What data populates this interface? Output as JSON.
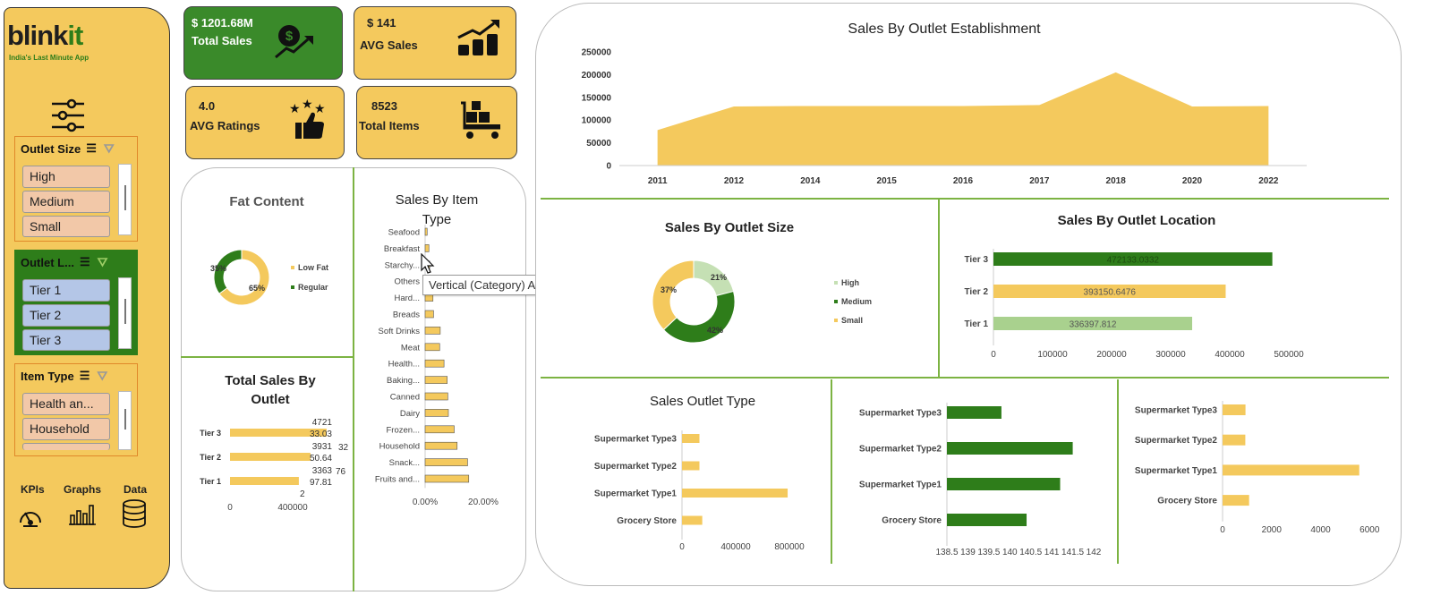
{
  "brand": {
    "name_a": "blink",
    "name_b": "it",
    "tagline": "India's Last Minute App"
  },
  "colors": {
    "yellow": "#f4c95d",
    "green": "#2e7d1a",
    "light_green": "#a9d18e",
    "peach": "#f2c8a8",
    "lavender": "#b4c6e7"
  },
  "slicers": [
    {
      "title": "Outlet Size",
      "items": [
        "High",
        "Medium",
        "Small"
      ]
    },
    {
      "title": "Outlet L...",
      "items": [
        "Tier 1",
        "Tier 2",
        "Tier 3"
      ]
    },
    {
      "title": "Item Type",
      "items": [
        "Health an...",
        "Household"
      ]
    }
  ],
  "nav": {
    "kpis": "KPIs",
    "graphs": "Graphs",
    "data": "Data"
  },
  "kpis": {
    "total_sales": {
      "value": "$ 1201.68M",
      "label": "Total Sales",
      "icon": "money-growth-icon"
    },
    "avg_sales": {
      "value": "$ 141",
      "label": "AVG Sales",
      "icon": "bar-growth-icon"
    },
    "avg_ratings": {
      "value": "4.0",
      "label": "AVG Ratings",
      "icon": "stars-thumbs-up-icon"
    },
    "total_items": {
      "value": "8523",
      "label": "Total Items",
      "icon": "cart-icon"
    }
  },
  "tooltip": "Vertical (Category) Axis",
  "chart_data": [
    {
      "id": "fat",
      "type": "pie",
      "title": "Fat Content",
      "labels": [
        "Low Fat",
        "Regular"
      ],
      "values": [
        65,
        35
      ],
      "value_labels": [
        "65%",
        "35%"
      ],
      "colors": [
        "#f4c95d",
        "#2e7d1a"
      ],
      "legend": "right"
    },
    {
      "id": "total_by_outlet",
      "type": "bar",
      "title": "Total Sales By Outlet",
      "categories": [
        "Tier 3",
        "Tier 2",
        "Tier 1"
      ],
      "values": [
        472133.03,
        393150.64,
        336397.81
      ],
      "label_lines": [
        [
          "4721",
          "33.03"
        ],
        [
          "3931",
          "50.64"
        ],
        [
          "3363",
          "97.81"
        ]
      ],
      "extra_labels": [
        "32",
        "76",
        "2"
      ],
      "xticks": [
        "0",
        "400000"
      ],
      "xmax": 700000
    },
    {
      "id": "item_type",
      "type": "bar",
      "title": "Sales By Item Type",
      "categories": [
        "Seafood",
        "Breakfast",
        "Starchy...",
        "Others",
        "Hard...",
        "Breads",
        "Soft Drinks",
        "Meat",
        "Health...",
        "Baking...",
        "Canned",
        "Dairy",
        "Frozen...",
        "Household",
        "Snack...",
        "Fruits and..."
      ],
      "values": [
        0.7,
        1.3,
        1.6,
        2.0,
        2.7,
        2.9,
        5.2,
        5.0,
        6.5,
        7.6,
        7.8,
        8.0,
        10.0,
        11.0,
        14.6,
        15.0
      ],
      "xticks": [
        "0.00%",
        "20.00%"
      ],
      "xmax": 20
    },
    {
      "id": "establishment",
      "type": "area",
      "title": "Sales By Outlet Establishment",
      "x": [
        "2011",
        "2012",
        "2014",
        "2015",
        "2016",
        "2017",
        "2018",
        "2020",
        "2022"
      ],
      "values": [
        78000,
        130000,
        131000,
        131000,
        131000,
        133000,
        205000,
        130000,
        131000
      ],
      "yticks": [
        "0",
        "50000",
        "100000",
        "150000",
        "200000",
        "250000"
      ],
      "ylim": [
        0,
        250000
      ]
    },
    {
      "id": "outlet_size",
      "type": "pie",
      "title": "Sales By Outlet Size",
      "labels": [
        "High",
        "Medium",
        "Small"
      ],
      "values": [
        21,
        42,
        37
      ],
      "value_labels": [
        "21%",
        "42%",
        "37%"
      ],
      "colors": [
        "#c5e0b4",
        "#2e7d1a",
        "#f4c95d"
      ],
      "legend": "right"
    },
    {
      "id": "outlet_location",
      "type": "bar",
      "title": "Sales By Outlet Location",
      "categories": [
        "Tier 3",
        "Tier 2",
        "Tier 1"
      ],
      "values": [
        472133.0332,
        393150.6476,
        336397.812
      ],
      "value_labels": [
        "472133.0332",
        "393150.6476",
        "336397.812"
      ],
      "colors": [
        "#2e7d1a",
        "#f4c95d",
        "#a9d18e"
      ],
      "xticks": [
        "0",
        "100000",
        "200000",
        "300000",
        "400000",
        "500000"
      ],
      "xmax": 500000
    },
    {
      "id": "outlet_type_sales",
      "type": "bar",
      "title": "Sales Outlet Type",
      "categories": [
        "Supermarket Type3",
        "Supermarket Type2",
        "Supermarket Type1",
        "Grocery Store"
      ],
      "values": [
        130000,
        130000,
        787000,
        151000
      ],
      "xticks": [
        "0",
        "400000",
        "800000"
      ],
      "xmax": 1000000
    },
    {
      "id": "outlet_type_green",
      "type": "bar",
      "title": "",
      "categories": [
        "Supermarket Type3",
        "Supermarket Type2",
        "Supermarket Type1",
        "Grocery Store"
      ],
      "values": [
        139.8,
        141.5,
        141.2,
        140.4
      ],
      "xticks": [
        "138.5",
        "139",
        "139.5",
        "140",
        "140.5",
        "141",
        "141.5",
        "142"
      ],
      "xmin": 138.5,
      "xmax": 142
    },
    {
      "id": "outlet_type_count",
      "type": "bar",
      "title": "",
      "categories": [
        "Supermarket Type3",
        "Supermarket Type2",
        "Supermarket Type1",
        "Grocery Store"
      ],
      "values": [
        935,
        928,
        5577,
        1083
      ],
      "xticks": [
        "0",
        "2000",
        "4000",
        "6000"
      ],
      "xmax": 6500
    }
  ]
}
